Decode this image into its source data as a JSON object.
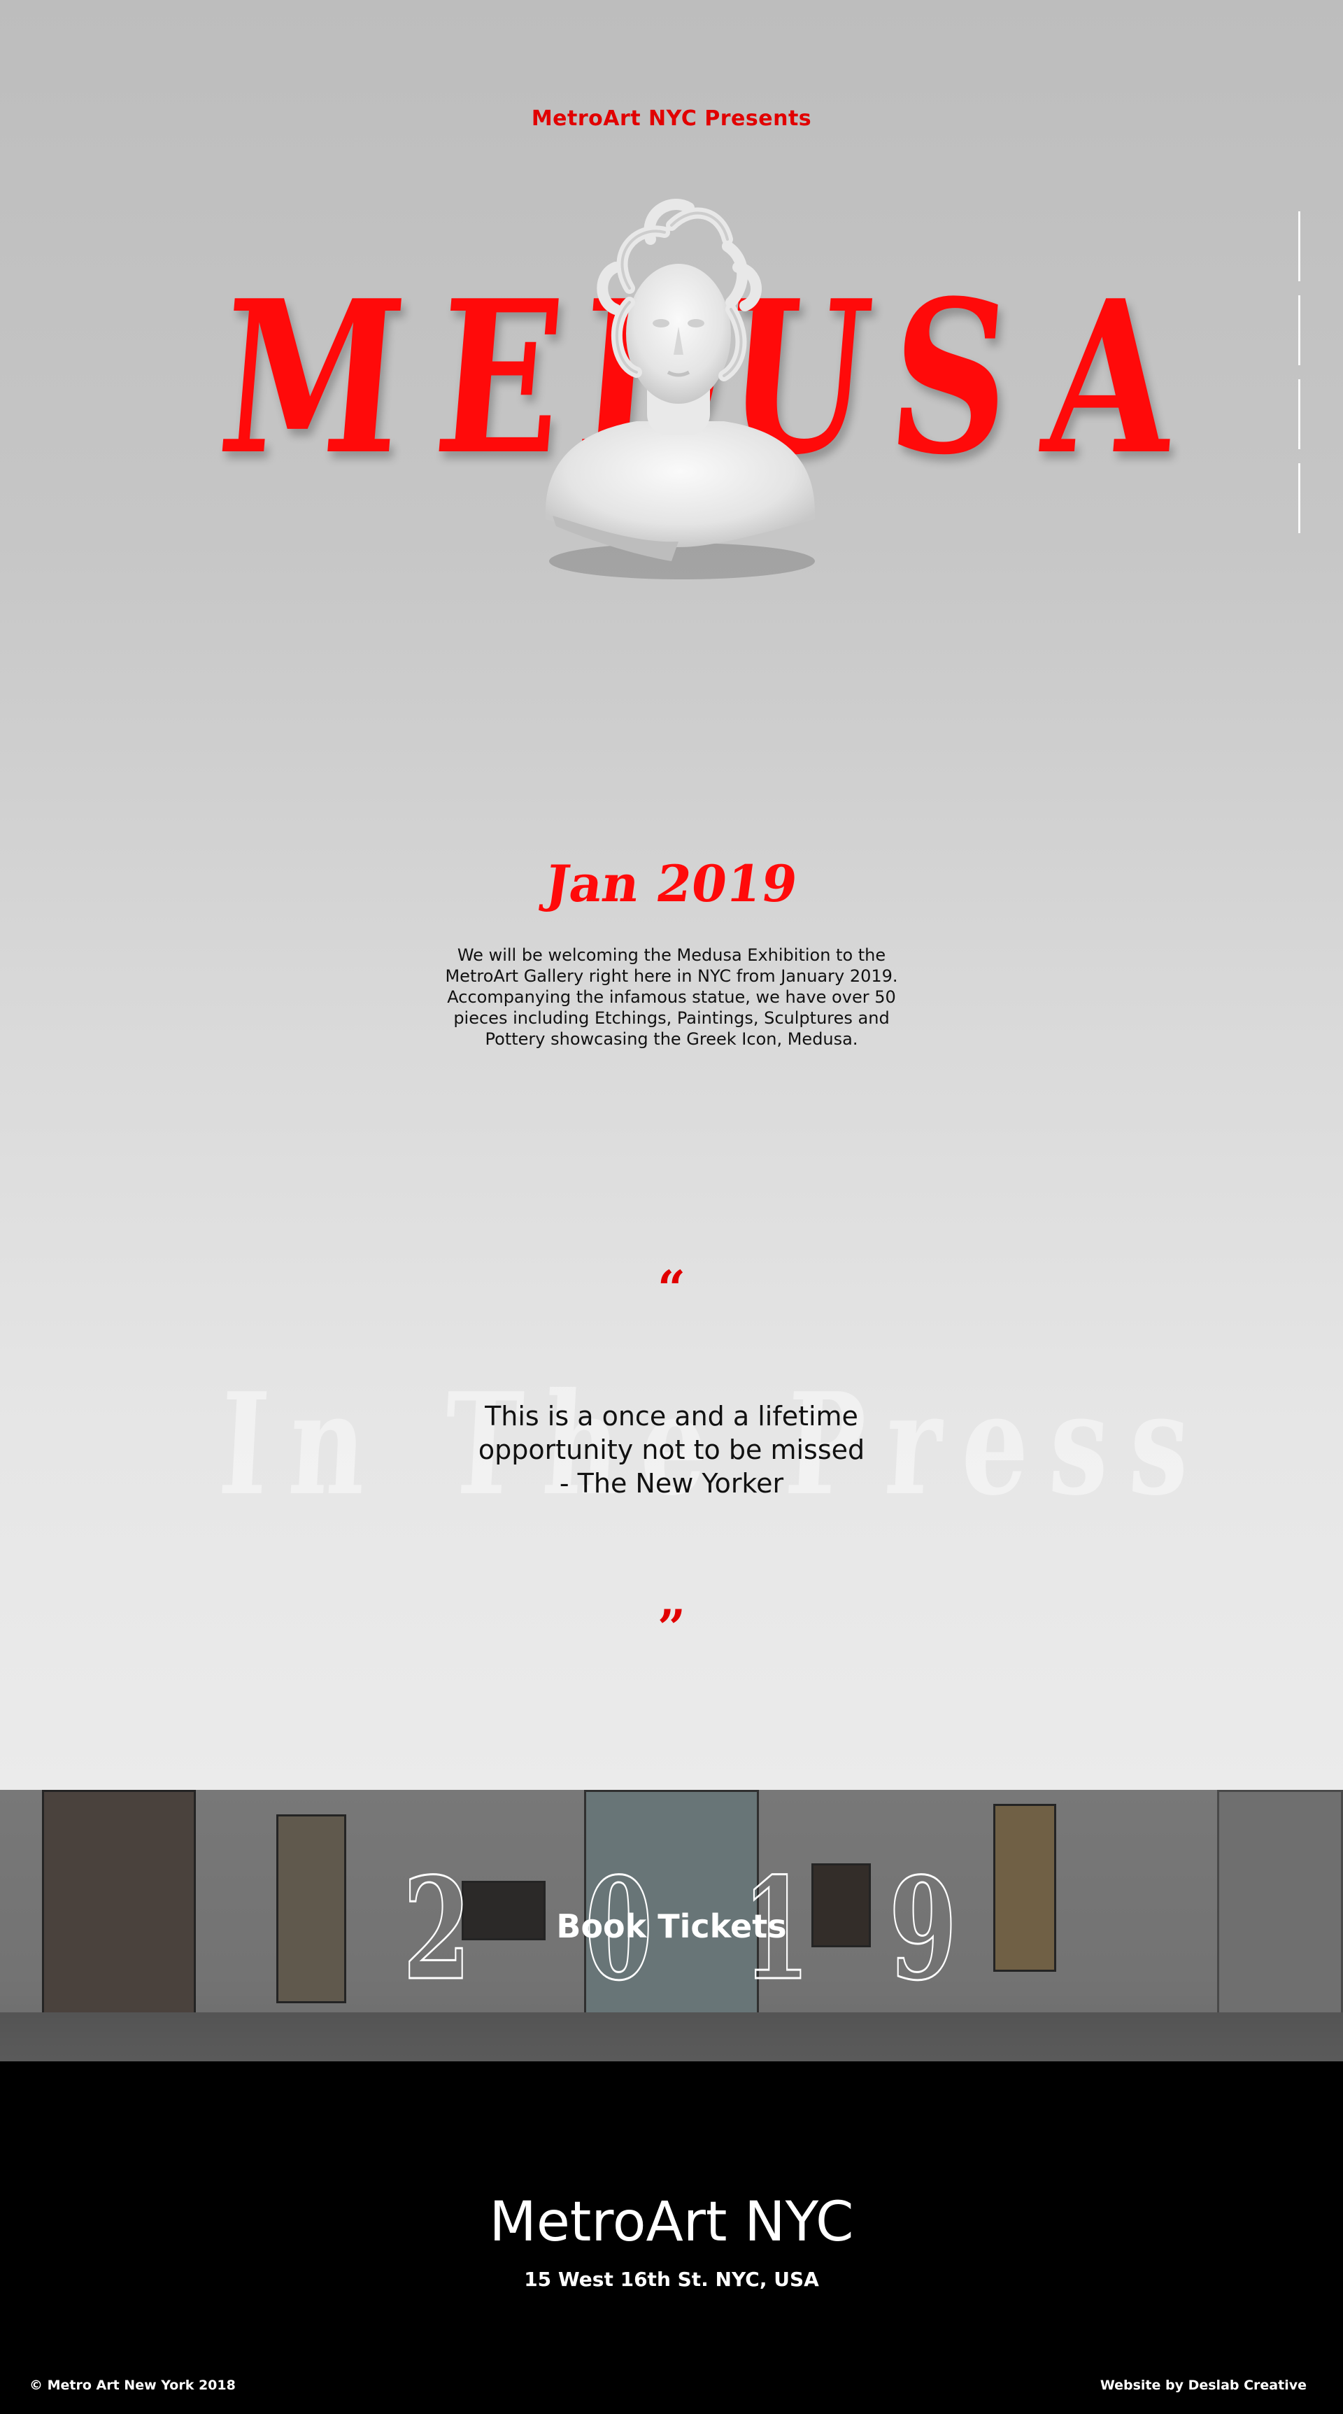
{
  "hero": {
    "presents": "MetroArt NYC Presents",
    "title_letters": [
      "M",
      "E",
      "D",
      "U",
      "S",
      "A"
    ],
    "side_nav_count": 4
  },
  "exhibition": {
    "date": "Jan 2019",
    "blurb": "We will be welcoming the Medusa Exhibition to the MetroArt Gallery right here in NYC from January 2019. Accompanying the infamous statue, we have over 50 pieces including Etchings, Paintings, Sculptures and Pottery showcasing the Greek Icon, Medusa."
  },
  "press": {
    "background_heading": "In The Press",
    "open_mark": "“",
    "close_mark": "”",
    "quote_line1": "This is a once and a lifetime",
    "quote_line2": "opportunity not to be missed",
    "quote_line3": "- The New Yorker"
  },
  "tickets": {
    "year_digits": [
      "2",
      "0",
      "1",
      "9"
    ],
    "button_label": "Book Tickets"
  },
  "footer": {
    "brand": "MetroArt NYC",
    "address": "15 West 16th St. NYC, USA",
    "copyright": "© Metro Art New York 2018",
    "credit": "Website by Deslab Creative"
  },
  "colors": {
    "accent_red": "#ff0a0a",
    "footer_bg": "#000000"
  }
}
